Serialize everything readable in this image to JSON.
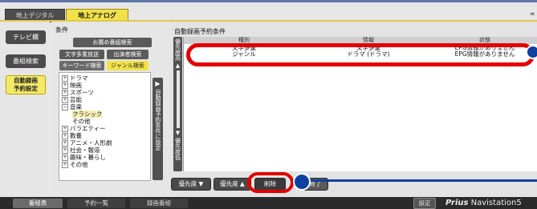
{
  "top_tabs": {
    "digital": "地上デジタル",
    "analog": "地上アナログ"
  },
  "top_right": "ᄎ",
  "left_nav": {
    "tv": "テレビ欄",
    "search": "番組検索",
    "auto_line1": "自動録画",
    "auto_line2": "予約設定"
  },
  "conditions": {
    "title": "条件",
    "recommended": "お薦め番組検索",
    "multiplex": "文字多重放送",
    "performer": "出演者検索",
    "keyword": "キーワード検索",
    "genre": "ジャンル検索",
    "tree": [
      {
        "toggle": "+",
        "label": "ドラマ"
      },
      {
        "toggle": "+",
        "label": "映画"
      },
      {
        "toggle": "+",
        "label": "スポーツ"
      },
      {
        "toggle": "+",
        "label": "芸能"
      },
      {
        "toggle": "−",
        "label": "音楽"
      },
      {
        "toggle": "",
        "label": "クラシック",
        "selected": true
      },
      {
        "toggle": "",
        "label": "その他"
      },
      {
        "toggle": "+",
        "label": "バラエティー"
      },
      {
        "toggle": "+",
        "label": "教養"
      },
      {
        "toggle": "+",
        "label": "アニメ・人形劇"
      },
      {
        "toggle": "+",
        "label": "社会・報道"
      },
      {
        "toggle": "+",
        "label": "趣味・暮らし"
      },
      {
        "toggle": "+",
        "label": "その他"
      }
    ],
    "arrow_label": "自動録画予約条件に設定"
  },
  "main": {
    "title": "自動録画予約条件",
    "priority_high": "優先度高",
    "priority_low": "優先度低",
    "columns": [
      "種別",
      "情報",
      "状態"
    ],
    "rows": [
      {
        "type": "文字多重",
        "info": "文字多重",
        "status": "EPG情報がありません"
      },
      {
        "type": "ジャンル",
        "info": "ドラマ (ドラマ)",
        "status": "EPG情報がありません"
      }
    ],
    "buttons": {
      "up": "優先度 ▼",
      "down": "優先度 ▲",
      "delete": "削除",
      "end": "終了"
    }
  },
  "bottom": {
    "program_table": "番組表",
    "reservation_list": "予約一覧",
    "recorded": "録画番組",
    "settings": "設定",
    "brand_bold": "Prius",
    "brand_rest": " Navistation5"
  },
  "colors": {
    "highlight_red": "#e30000",
    "callout_blue": "#1040a0",
    "accent_yellow": "#f2e14a"
  }
}
